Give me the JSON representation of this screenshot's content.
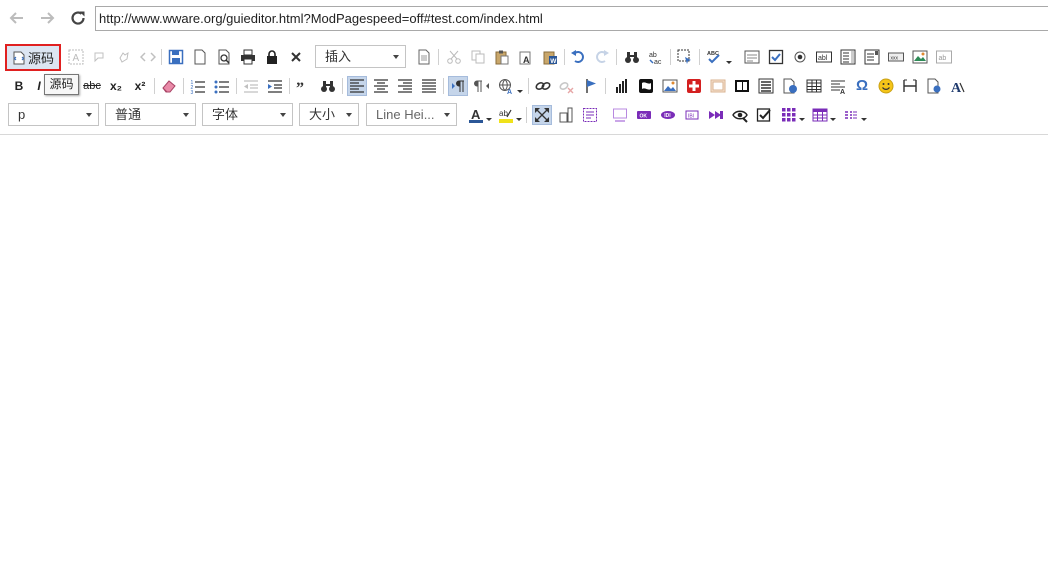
{
  "browser": {
    "url": "http://www.wware.org/guieditor.html?ModPagespeed=off#test.com/index.html"
  },
  "toolbar": {
    "source_label": "源码",
    "tooltip": "源码",
    "insert_combo": "插入",
    "format_combo": "p",
    "style_combo": "普通",
    "font_combo": "字体",
    "size_combo": "大小",
    "lineheight_combo": "Line Hei...",
    "bold": "B",
    "italic": "I",
    "strike": "abc",
    "subscript": "x₂",
    "superscript": "x²",
    "omega": "Ω",
    "colors": {
      "accent": "#3a6fbf",
      "red": "#e02020",
      "purple": "#7a2cb8",
      "green": "#2e8b57",
      "orange": "#e0892f"
    }
  }
}
